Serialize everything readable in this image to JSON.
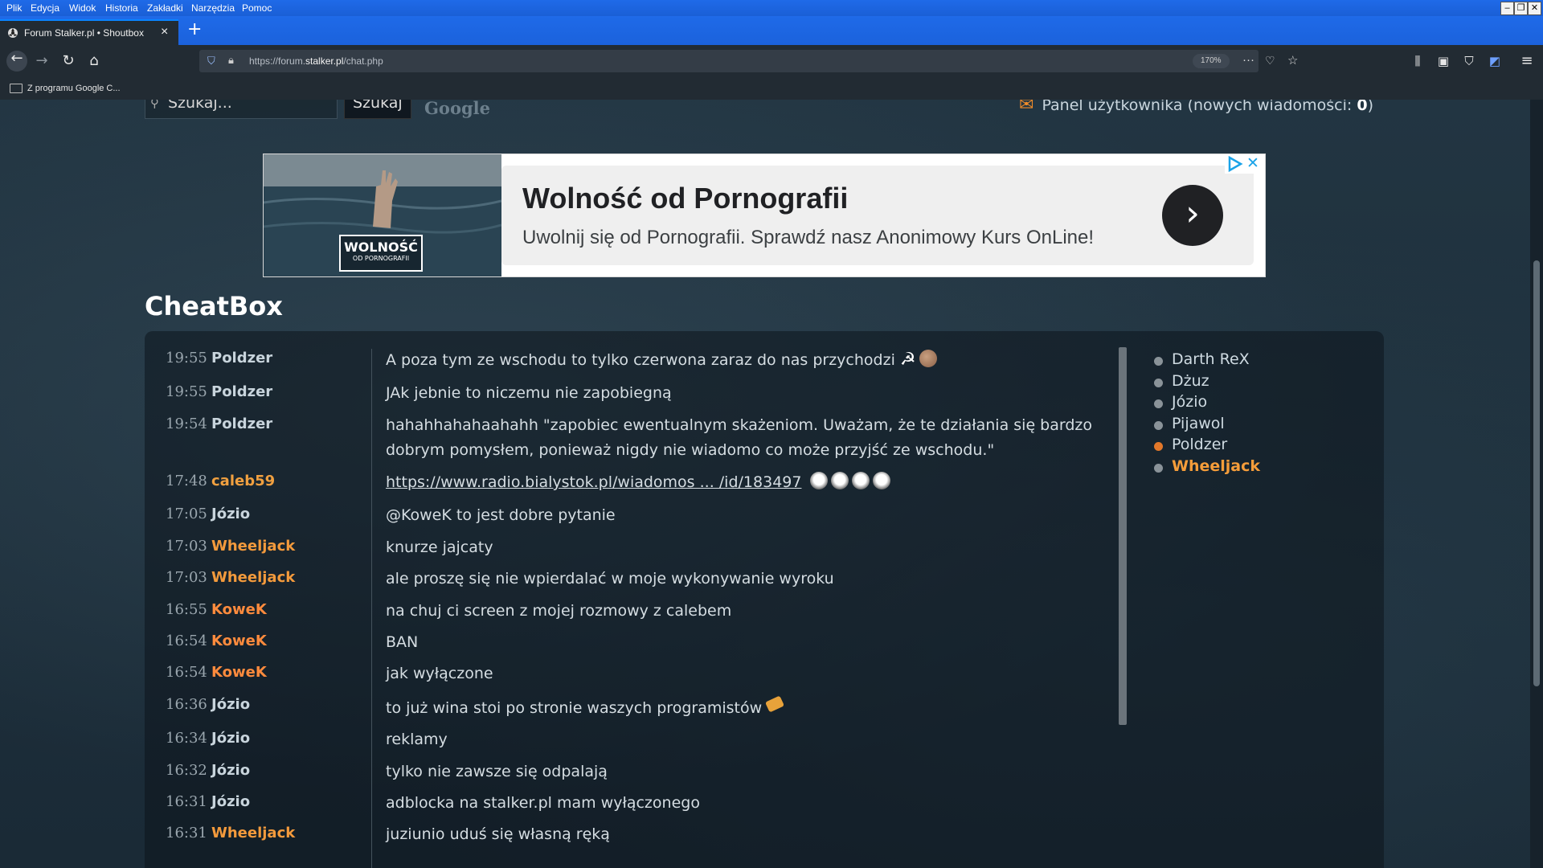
{
  "browser": {
    "menu": [
      "Plik",
      "Edycja",
      "Widok",
      "Historia",
      "Zakładki",
      "Narzędzia",
      "Pomoc"
    ],
    "tab_title": "Forum Stalker.pl • Shoutbox",
    "url_prefix": "https://forum.",
    "url_domain": "stalker.pl",
    "url_path": "/chat.php",
    "zoom": "170%",
    "bookmark": "Z programu Google C..."
  },
  "header": {
    "search_placeholder": "Szukaj...",
    "search_button": "Szukaj",
    "google_label": "Google",
    "panel_label": "Panel użytkownika (nowych wiadomości:",
    "new_messages": "0",
    "panel_close": ")"
  },
  "ad": {
    "logo_line1": "WOLNOŚĆ",
    "logo_line2": "OD PORNOGRAFII",
    "title": "Wolność od Pornografii",
    "description": "Uwolnij się od Pornografii. Sprawdź nasz Anonimowy Kurs OnLine!",
    "arrow": "›",
    "close": "✕"
  },
  "chat": {
    "title": "CheatBox",
    "messages": [
      {
        "time": "19:55",
        "author": "Poldzer",
        "text": "A poza tym ze wschodu to tylko czerwona zaraz do nas przychodzi"
      },
      {
        "time": "19:55",
        "author": "Poldzer",
        "text": "JAk jebnie to niczemu nie zapobiegną"
      },
      {
        "time": "19:54",
        "author": "Poldzer",
        "text": "hahahhahahaahahh \"zapobiec ewentualnym skażeniom. Uważam, że te działania się bardzo dobrym pomysłem, ponieważ nigdy nie wiadomo co może przyjść ze wschodu.\""
      },
      {
        "time": "17:48",
        "author": "caleb59",
        "text": "https://www.radio.bialystok.pl/wiadomos ... /id/183497"
      },
      {
        "time": "17:05",
        "author": "Józio",
        "text": "@KoweK to jest dobre pytanie"
      },
      {
        "time": "17:03",
        "author": "Wheeljack",
        "text": "knurze jajcaty"
      },
      {
        "time": "17:03",
        "author": "Wheeljack",
        "text": "ale proszę się nie wpierdalać w moje wykonywanie wyroku"
      },
      {
        "time": "16:55",
        "author": "KoweK",
        "text": "na chuj ci screen z mojej rozmowy z calebem"
      },
      {
        "time": "16:54",
        "author": "KoweK",
        "text": "BAN"
      },
      {
        "time": "16:54",
        "author": "KoweK",
        "text": "jak wyłączone"
      },
      {
        "time": "16:36",
        "author": "Józio",
        "text": "to już wina stoi po stronie waszych programistów"
      },
      {
        "time": "16:34",
        "author": "Józio",
        "text": "reklamy"
      },
      {
        "time": "16:32",
        "author": "Józio",
        "text": "tylko nie zawsze się odpalają"
      },
      {
        "time": "16:31",
        "author": "Józio",
        "text": "adblocka na stalker.pl mam wyłączonego"
      },
      {
        "time": "16:31",
        "author": "Wheeljack",
        "text": "juziunio uduś się własną ręką"
      }
    ],
    "online": [
      "Darth ReX",
      "Dżuz",
      "Józio",
      "Pijawol",
      "Poldzer",
      "Wheeljack"
    ]
  },
  "colors": {
    "author_poldzer": "#c8d4dc",
    "author_caleb": "#f0a040",
    "author_jozio": "#c8d4dc",
    "author_wheeljack": "#f39a3c",
    "author_kowek": "#ff8b3d",
    "online_highlight": "#f59d3a"
  }
}
